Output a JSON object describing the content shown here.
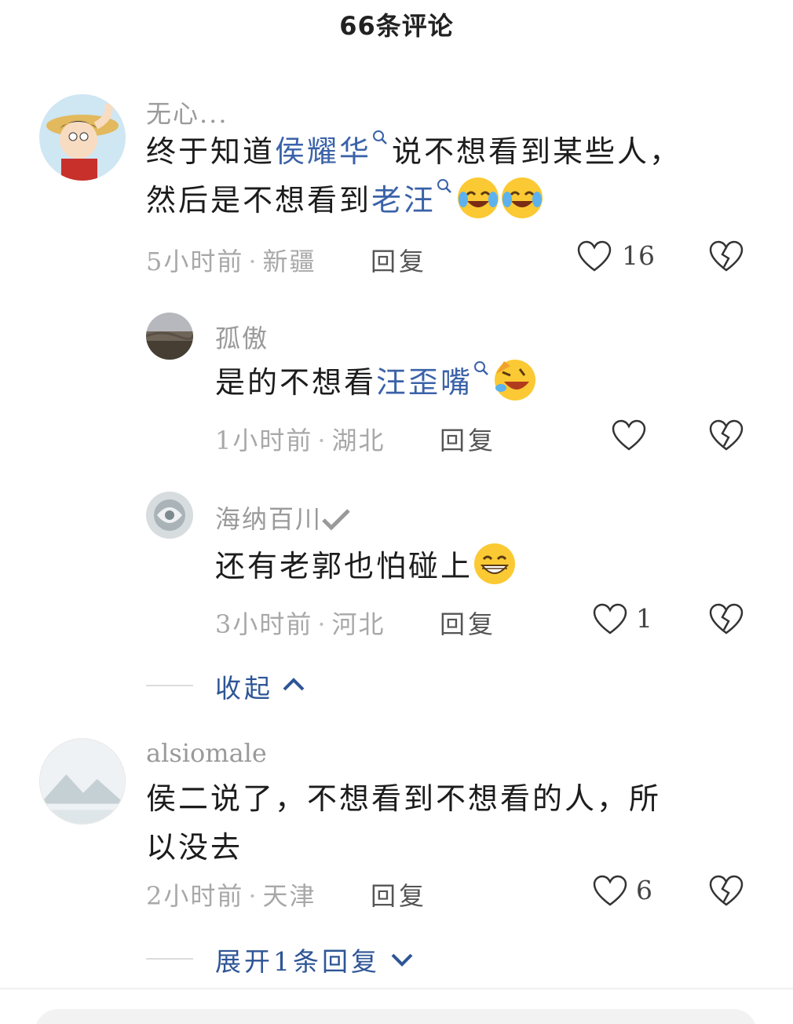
{
  "header": {
    "title": "66条评论"
  },
  "comments": [
    {
      "user": "无心...",
      "text": {
        "p1": "终于知道",
        "link1": "侯耀华",
        "p2": "说不想看到某些人，",
        "p3": "然后是不想看到",
        "link2": "老汪"
      },
      "emojis": [
        "laugh-cry-emoji",
        "laugh-cry-emoji"
      ],
      "time": "5小时前",
      "location": "新疆",
      "reply_label": "回复",
      "likes": "16"
    },
    {
      "user": "孤傲",
      "text": {
        "p1": "是的不想看",
        "link1": "汪歪嘴"
      },
      "emojis": [
        "rofl-emoji"
      ],
      "time": "1小时前",
      "location": "湖北",
      "reply_label": "回复",
      "likes": ""
    },
    {
      "user": "海纳百川",
      "text": {
        "p1": "还有老郭也怕碰上"
      },
      "emojis": [
        "grin-emoji"
      ],
      "time": "3小时前",
      "location": "河北",
      "reply_label": "回复",
      "likes": "1"
    },
    {
      "user": "alsiomale",
      "text": {
        "p1": "侯二说了，不想看到不想看的人，所",
        "p2": "以没去"
      },
      "time": "2小时前",
      "location": "天津",
      "reply_label": "回复",
      "likes": "6"
    }
  ],
  "collapse_label": "收起",
  "expand_label": "展开1条回复",
  "colors": {
    "link": "#3b62a8",
    "meta": "#a8a8a8",
    "action": "#2e5596"
  }
}
